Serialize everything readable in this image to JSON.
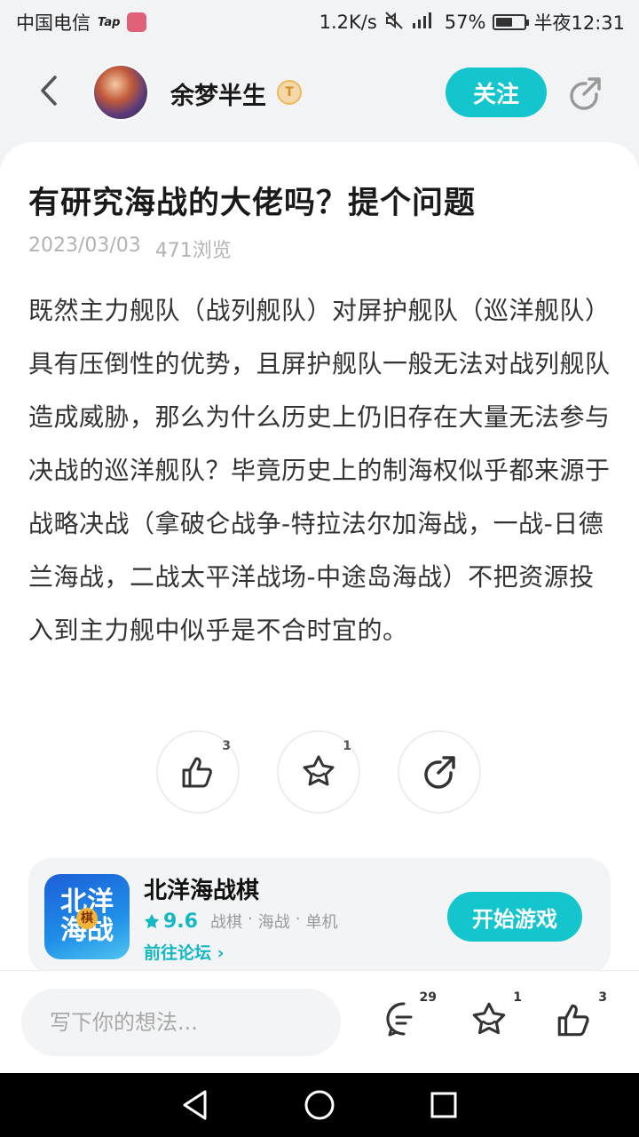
{
  "status_bar": {
    "carrier": "中国电信",
    "tap_badge": "Tap",
    "net_speed": "1.2K/s",
    "network": "4G 2G",
    "battery": "57%",
    "battery_level": 0.57,
    "time": "半夜12:31"
  },
  "header": {
    "username": "余梦半生",
    "level_badge": "T",
    "follow_label": "关注"
  },
  "post": {
    "title": "有研究海战的大佬吗？提个问题",
    "date": "2023/03/03",
    "views": "471浏览",
    "body": "既然主力舰队（战列舰队）对屏护舰队（巡洋舰队）具有压倒性的优势，且屏护舰队一般无法对战列舰队造成威胁，那么为什么历史上仍旧存在大量无法参与决战的巡洋舰队？毕竟历史上的制海权似乎都来源于战略决战（拿破仑战争-特拉法尔加海战，一战-日德兰海战，二战太平洋战场-中途岛海战）不把资源投入到主力舰中似乎是不合时宜的。",
    "like_count": "3",
    "favorite_count": "1"
  },
  "game": {
    "name": "北洋海战棋",
    "icon_text_top": "北洋",
    "icon_text_bottom": "海战",
    "icon_badge": "棋",
    "rating": "9.6",
    "tags": [
      "战棋",
      "海战",
      "单机"
    ],
    "tag_separator": "·",
    "forum_link": "前往论坛 ›",
    "play_label": "开始游戏"
  },
  "bottom_bar": {
    "comment_placeholder": "写下你的想法...",
    "comment_count": "29",
    "favorite_count": "1",
    "like_count": "3"
  },
  "colors": {
    "accent": "#15c5ce",
    "page_bg": "#f2f3f5",
    "card_bg": "#ffffff"
  }
}
